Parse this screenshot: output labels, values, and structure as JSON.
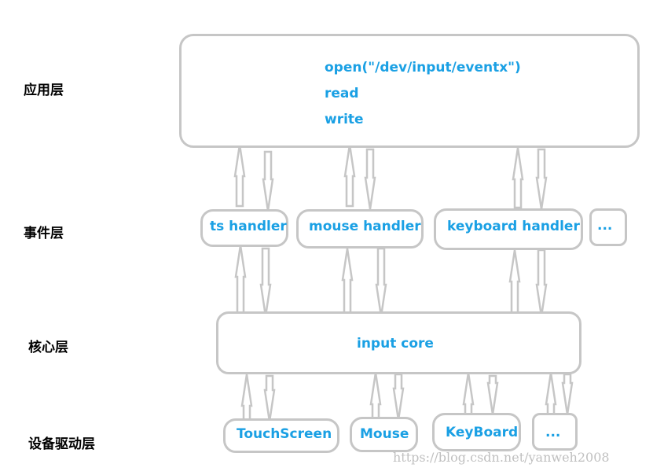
{
  "layers": {
    "app": "应用层",
    "event": "事件层",
    "core": "核心层",
    "driver": "设备驱动层"
  },
  "app_box": {
    "lines": [
      "open(\"/dev/input/eventx\")",
      "read",
      "write"
    ]
  },
  "handlers": [
    "ts handler",
    "mouse handler",
    "keyboard handler",
    "..."
  ],
  "core_box": {
    "label": "input core"
  },
  "drivers": [
    "TouchScreen",
    "Mouse",
    "KeyBoard",
    "..."
  ],
  "watermark": "https://blog.csdn.net/yanweh2008",
  "colors": {
    "text": "#1aa0e4",
    "border": "#c6c6c6"
  }
}
